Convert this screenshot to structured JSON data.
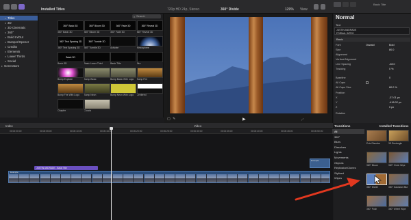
{
  "browser": {
    "header": "Installed Titles",
    "search_placeholder": "Search",
    "categories": [
      "Titles",
      "3D",
      "3D Cinematic",
      "360°",
      "Build In/Out",
      "Bumper/Opener",
      "Credits",
      "Elements",
      "Lower Thirds",
      "Social",
      "Generators"
    ],
    "tiles": [
      {
        "thumb": "360° Basic 3D",
        "label": "360° Basic 3D"
      },
      {
        "thumb": "360° Bloom 3D",
        "label": "360° Bloom 3D"
      },
      {
        "thumb": "360° Fade 3D",
        "label": "360° Fade 3D"
      },
      {
        "thumb": "360° Reveal 3D",
        "label": "360° Reveal 3D"
      },
      {
        "thumb": "360° Text Spacing 3D",
        "label": "360° Text Spacing 3D"
      },
      {
        "thumb": "360° Tumble 3D",
        "label": "360° Tumble 3D"
      },
      {
        "thumb": "",
        "label": "Activate"
      },
      {
        "thumb": "",
        "label": "Atmosphere"
      },
      {
        "thumb": "Basic 3D",
        "label": "Basic 3D"
      },
      {
        "thumb": "",
        "label": "Basic Lower Third"
      },
      {
        "thumb": "",
        "label": "Basic Title"
      },
      {
        "thumb": "",
        "label": "Blur"
      },
      {
        "thumb": "",
        "label": "Bump Explode"
      },
      {
        "thumb": "",
        "label": "Bump Basic"
      },
      {
        "thumb": "",
        "label": "Bump Basic With Logo"
      },
      {
        "thumb": "",
        "label": "Bump Fire"
      },
      {
        "thumb": "",
        "label": "Bump Fire With Logo"
      },
      {
        "thumb": "",
        "label": "Bump Neon"
      },
      {
        "thumb": "",
        "label": "Bump Neon With Logo"
      },
      {
        "thumb": "",
        "label": "Centered"
      },
      {
        "thumb": "",
        "label": "Chapter"
      },
      {
        "thumb": "",
        "label": "Clouds"
      }
    ]
  },
  "viewer": {
    "header_left": "720p HD 24p, Stereo",
    "project_name": "360° Divide",
    "zoom": "129%",
    "view": "View"
  },
  "inspector": {
    "clip_info": "Basic Title",
    "title": "Normal",
    "text_section": "Text",
    "text_preview_1": "JUSTIN ANDRADE",
    "text_preview_2": "FORMAL INTRO",
    "basic_label": "Basic",
    "font_label": "Font",
    "font_value": "Oswald",
    "weight_value": "Bold",
    "size_label": "Size",
    "size_value": "80.0",
    "alignment_label": "Alignment",
    "vert_align_label": "Vertical Alignment",
    "line_spacing_label": "Line Spacing",
    "line_spacing_value": "-28.0",
    "tracking_label": "Tracking",
    "tracking_value": "0 %",
    "baseline_label": "Baseline",
    "baseline_value": "0",
    "allcaps_label": "All Caps",
    "allcaps_size_label": "All Caps Size",
    "allcaps_size_value": "80.0 %",
    "position_label": "Position",
    "pos_x_label": "X",
    "pos_x_value": "-37.01 px",
    "pos_y_label": "Y",
    "pos_y_value": "-418.02 px",
    "pos_z_label": "Z",
    "pos_z_value": "0 px",
    "rotation_label": "Rotation"
  },
  "timeline": {
    "index_label": "Index",
    "timecode": "Video",
    "clip_title": "JUSTIN ANDRADE - Basic Title",
    "ruler": [
      "00:00:00:00",
      "00:00:05:00",
      "00:00:10:00",
      "00:00:15:00",
      "00:00:20:00",
      "00:00:25:00",
      "00:00:30:00",
      "00:00:35:00",
      "00:00:40:00",
      "00:00:45:00",
      "00:00:50:00"
    ],
    "main_clip_label": "Example",
    "end_clip_label": "Example"
  },
  "transitions": {
    "header_left": "Transitions",
    "header_right": "Installed Transitions",
    "categories": [
      "All",
      "360°",
      "Blurs",
      "Dissolves",
      "Lights",
      "Movements",
      "Objects",
      "Replicator/Clones",
      "Stylized",
      "Wipes"
    ],
    "tiles": [
      {
        "label": "Ecto Dissolve"
      },
      {
        "label": "3D Rectangle"
      },
      {
        "label": "360° Bloom"
      },
      {
        "label": "360° Circle Wipe"
      },
      {
        "label": "360° Divide"
      },
      {
        "label": "360° Gaussian Blur"
      },
      {
        "label": "360° Push"
      },
      {
        "label": "360° Wheel Wipe"
      }
    ]
  },
  "colors": {
    "accent": "#7d68c9",
    "selection": "#3a5d9a",
    "title_clip": "#6a4fc0",
    "annotation_arrow": "#e2381f"
  }
}
